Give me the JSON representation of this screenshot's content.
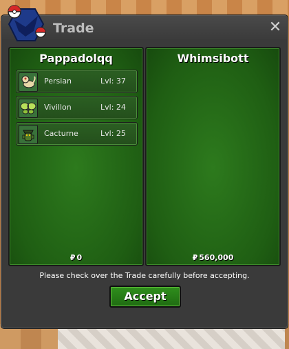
{
  "window": {
    "title": "Trade",
    "close_glyph": "✕"
  },
  "left_panel": {
    "name": "Pappadolqq",
    "currency_symbol": "₽",
    "money": "0",
    "pokemon": [
      {
        "name": "Persian",
        "level": "Lvl: 37",
        "icon": "persian-sprite-icon"
      },
      {
        "name": "Vivillon",
        "level": "Lvl: 24",
        "icon": "vivillon-sprite-icon"
      },
      {
        "name": "Cacturne",
        "level": "Lvl: 25",
        "icon": "cacturne-sprite-icon"
      }
    ]
  },
  "right_panel": {
    "name": "Whimsibott",
    "currency_symbol": "₽",
    "money": "560,000",
    "pokemon": []
  },
  "notice": "Please check over the Trade carefully before accepting.",
  "accept_label": "Accept",
  "colors": {
    "panel_green": "#1f5e13",
    "accept_green": "#2f8f1c",
    "window_bg": "#3a3a3a"
  }
}
